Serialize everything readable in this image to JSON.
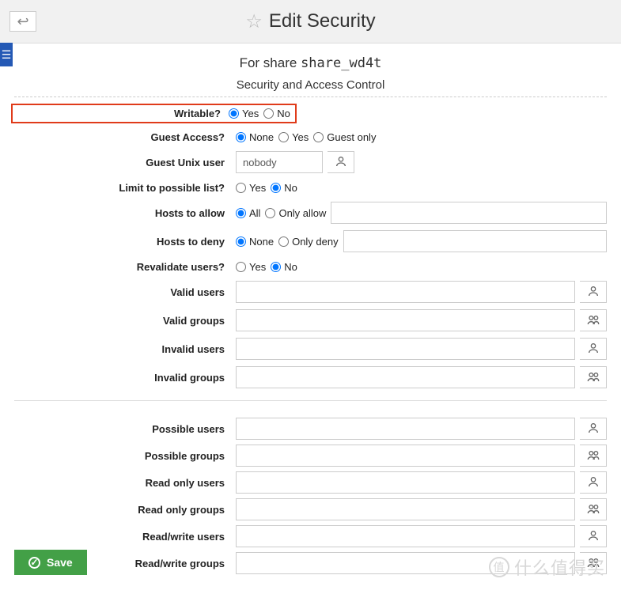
{
  "header": {
    "title": "Edit Security"
  },
  "share": {
    "prefix": "For share",
    "name": "share_wd4t",
    "section": "Security and Access Control"
  },
  "form": {
    "writable": {
      "label": "Writable?",
      "yes": "Yes",
      "no": "No",
      "selected": "Yes"
    },
    "guest_access": {
      "label": "Guest Access?",
      "none": "None",
      "yes": "Yes",
      "guest_only": "Guest only",
      "selected": "None"
    },
    "guest_unix_user": {
      "label": "Guest Unix user",
      "value": "nobody"
    },
    "limit_possible": {
      "label": "Limit to possible list?",
      "yes": "Yes",
      "no": "No",
      "selected": "No"
    },
    "hosts_allow": {
      "label": "Hosts to allow",
      "all": "All",
      "only_allow": "Only allow",
      "selected": "All",
      "value": ""
    },
    "hosts_deny": {
      "label": "Hosts to deny",
      "none": "None",
      "only_deny": "Only deny",
      "selected": "None",
      "value": ""
    },
    "revalidate": {
      "label": "Revalidate users?",
      "yes": "Yes",
      "no": "No",
      "selected": "No"
    },
    "valid_users": {
      "label": "Valid users",
      "value": "",
      "picker": "user"
    },
    "valid_groups": {
      "label": "Valid groups",
      "value": "",
      "picker": "group"
    },
    "invalid_users": {
      "label": "Invalid users",
      "value": "",
      "picker": "user"
    },
    "invalid_groups": {
      "label": "Invalid groups",
      "value": "",
      "picker": "group"
    },
    "possible_users": {
      "label": "Possible users",
      "value": "",
      "picker": "user"
    },
    "possible_groups": {
      "label": "Possible groups",
      "value": "",
      "picker": "group"
    },
    "readonly_users": {
      "label": "Read only users",
      "value": "",
      "picker": "user"
    },
    "readonly_groups": {
      "label": "Read only groups",
      "value": "",
      "picker": "group"
    },
    "readwrite_users": {
      "label": "Read/write users",
      "value": "",
      "picker": "user"
    },
    "readwrite_groups": {
      "label": "Read/write groups",
      "value": "",
      "picker": "group"
    }
  },
  "save": "Save",
  "watermark": "什么值得买"
}
